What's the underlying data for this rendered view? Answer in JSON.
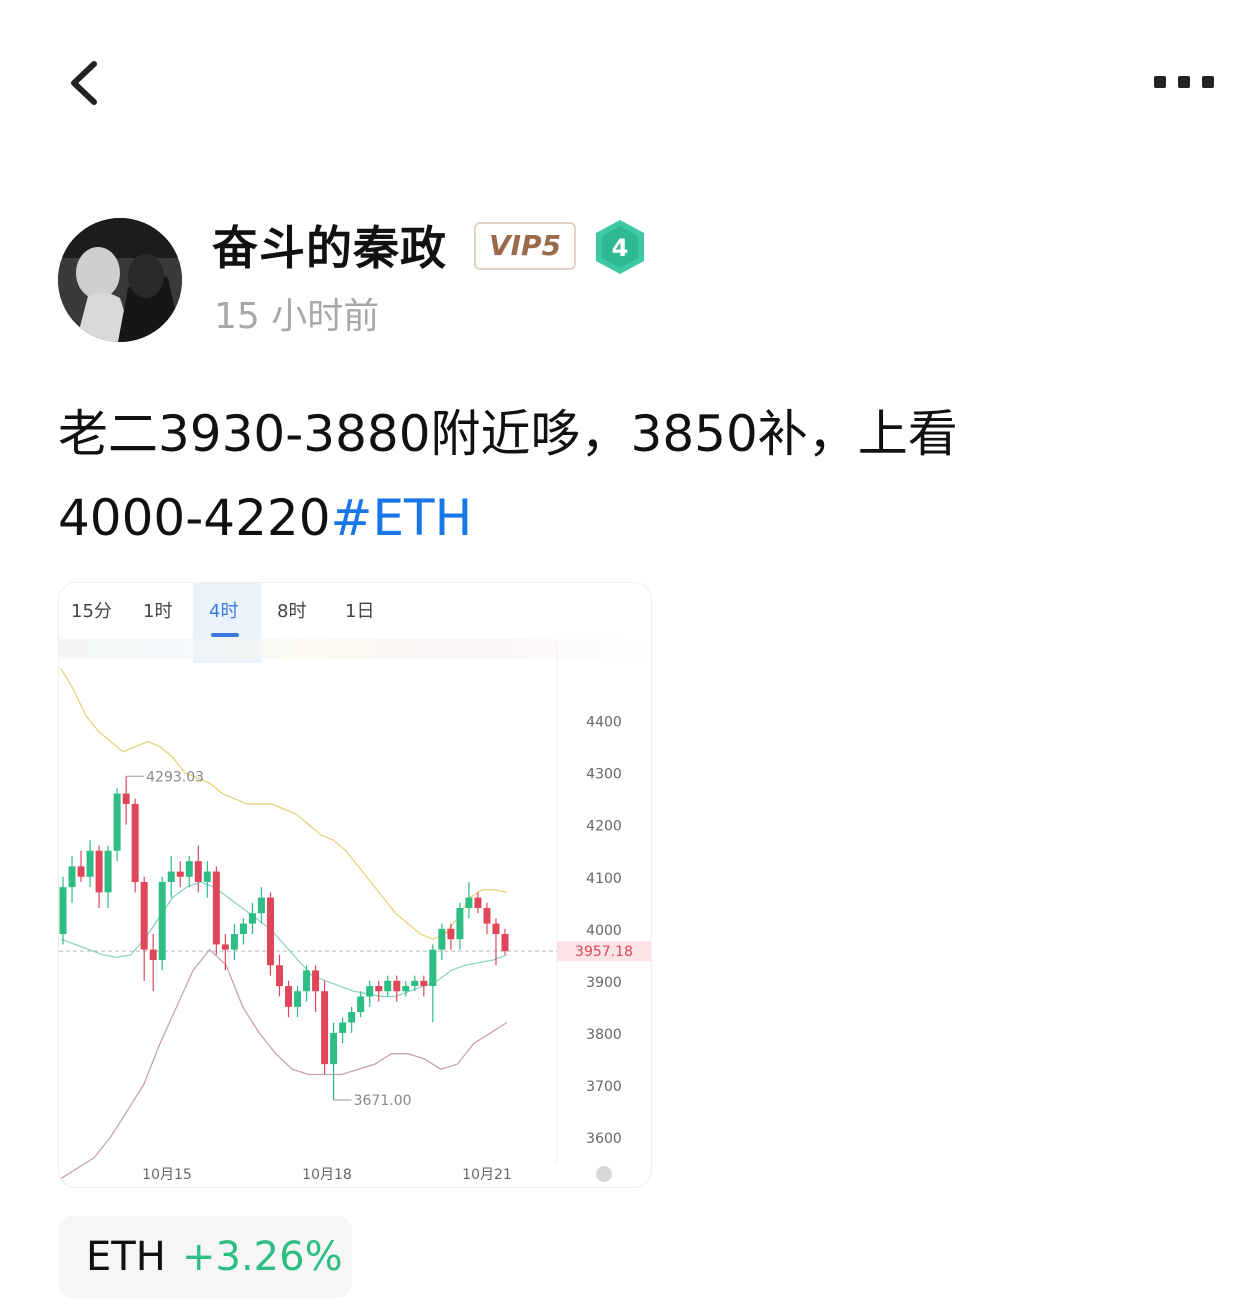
{
  "header": {
    "back_icon": "chevron-left-icon",
    "more_icon": "more-dots-icon"
  },
  "author": {
    "name": "奋斗的秦政",
    "vip": "VIP5",
    "level": "4",
    "time": "15 小时前"
  },
  "post": {
    "text": "老二3930-3880附近哆，3850补，上看4000-4220",
    "hashtag": "#ETH"
  },
  "chart": {
    "tabs": [
      "15分",
      "1时",
      "4时",
      "8时",
      "1日"
    ],
    "active_tab": "4时",
    "price_tag": "3957.18",
    "high_label": "4293.03",
    "low_label": "3671.00",
    "colors": {
      "up": "#2ebd85",
      "down": "#e0465a",
      "upper_band": "#e6d27a",
      "mid_band": "#8ed0c8",
      "lower_band": "#c9a0b8"
    }
  },
  "chart_data": {
    "type": "candlestick",
    "title": "",
    "x_ticks": [
      "10月15",
      "10月18",
      "10月21"
    ],
    "y_ticks": [
      4400,
      4300,
      4200,
      4100,
      4000,
      3900,
      3800,
      3700,
      3600
    ],
    "ylim": [
      3550,
      4480
    ],
    "current_price": 3957.18,
    "annotations": [
      {
        "text": "4293.03",
        "value": 4293.03
      },
      {
        "text": "3671.00",
        "value": 3671.0
      }
    ],
    "candles": [
      [
        3990,
        4080,
        4100,
        3970
      ],
      [
        4080,
        4120,
        4140,
        4050
      ],
      [
        4120,
        4100,
        4150,
        4090
      ],
      [
        4100,
        4150,
        4170,
        4080
      ],
      [
        4150,
        4070,
        4160,
        4040
      ],
      [
        4070,
        4150,
        4160,
        4040
      ],
      [
        4150,
        4260,
        4270,
        4130
      ],
      [
        4260,
        4240,
        4293.03,
        4200
      ],
      [
        4240,
        4090,
        4250,
        4070
      ],
      [
        4090,
        3960,
        4100,
        3900
      ],
      [
        3960,
        3940,
        3990,
        3880
      ],
      [
        3940,
        4090,
        4100,
        3920
      ],
      [
        4090,
        4110,
        4140,
        4060
      ],
      [
        4110,
        4100,
        4130,
        4080
      ],
      [
        4100,
        4130,
        4140,
        4080
      ],
      [
        4130,
        4090,
        4160,
        4070
      ],
      [
        4090,
        4110,
        4130,
        4060
      ],
      [
        4110,
        3970,
        4120,
        3950
      ],
      [
        3970,
        3960,
        3990,
        3920
      ],
      [
        3960,
        3990,
        4010,
        3940
      ],
      [
        3990,
        4010,
        4020,
        3970
      ],
      [
        4010,
        4030,
        4050,
        3990
      ],
      [
        4030,
        4060,
        4080,
        4010
      ],
      [
        4060,
        3930,
        4070,
        3910
      ],
      [
        3930,
        3890,
        3950,
        3870
      ],
      [
        3890,
        3850,
        3900,
        3830
      ],
      [
        3850,
        3880,
        3890,
        3830
      ],
      [
        3880,
        3920,
        3930,
        3860
      ],
      [
        3920,
        3880,
        3930,
        3840
      ],
      [
        3880,
        3740,
        3900,
        3720
      ],
      [
        3740,
        3800,
        3820,
        3671
      ],
      [
        3800,
        3820,
        3830,
        3780
      ],
      [
        3820,
        3840,
        3850,
        3800
      ],
      [
        3840,
        3870,
        3880,
        3830
      ],
      [
        3870,
        3890,
        3900,
        3850
      ],
      [
        3890,
        3880,
        3900,
        3860
      ],
      [
        3880,
        3900,
        3910,
        3870
      ],
      [
        3900,
        3880,
        3910,
        3860
      ],
      [
        3880,
        3890,
        3900,
        3870
      ],
      [
        3890,
        3900,
        3910,
        3880
      ],
      [
        3900,
        3890,
        3910,
        3870
      ],
      [
        3890,
        3960,
        3970,
        3820
      ],
      [
        3960,
        4000,
        4010,
        3940
      ],
      [
        4000,
        3980,
        4010,
        3960
      ],
      [
        3980,
        4040,
        4050,
        3960
      ],
      [
        4040,
        4060,
        4090,
        4020
      ],
      [
        4060,
        4040,
        4070,
        4030
      ],
      [
        4040,
        4010,
        4050,
        3990
      ],
      [
        4010,
        3990,
        4020,
        3930
      ],
      [
        3990,
        3957.18,
        4000,
        3950
      ]
    ],
    "bollinger": {
      "upper": [
        4500,
        4460,
        4410,
        4380,
        4360,
        4340,
        4350,
        4360,
        4350,
        4330,
        4300,
        4290,
        4280,
        4260,
        4250,
        4240,
        4240,
        4240,
        4230,
        4220,
        4200,
        4180,
        4170,
        4150,
        4120,
        4090,
        4060,
        4030,
        4010,
        3990,
        3980,
        3990,
        4020,
        4060,
        4075,
        4075,
        4070
      ],
      "mid": [
        3980,
        3970,
        3960,
        3950,
        3945,
        3950,
        3980,
        4020,
        4060,
        4080,
        4090,
        4080,
        4060,
        4040,
        4020,
        4000,
        3970,
        3940,
        3910,
        3900,
        3890,
        3880,
        3875,
        3870,
        3870,
        3880,
        3890,
        3900,
        3920,
        3930,
        3935,
        3940,
        3950
      ],
      "lower": [
        3520,
        3540,
        3560,
        3600,
        3650,
        3700,
        3780,
        3850,
        3920,
        3960,
        3930,
        3850,
        3800,
        3760,
        3730,
        3720,
        3720,
        3720,
        3730,
        3740,
        3760,
        3760,
        3750,
        3730,
        3740,
        3780,
        3800,
        3820
      ]
    },
    "grid": true
  },
  "coin": {
    "name": "ETH",
    "change": "+3.26%"
  }
}
